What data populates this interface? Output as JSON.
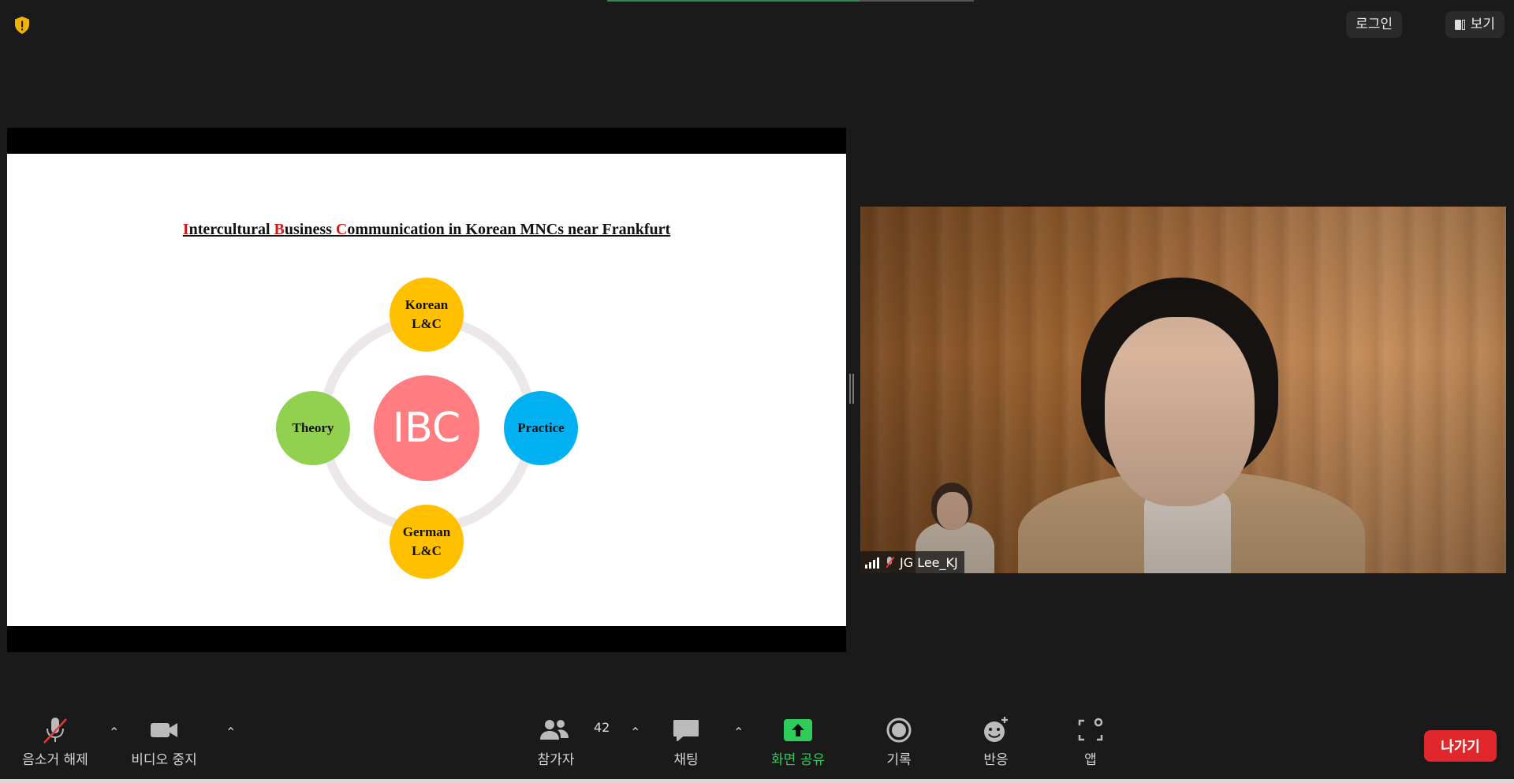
{
  "topbar": {
    "login_label": "로그인",
    "view_label": "보기"
  },
  "slide": {
    "title_parts": [
      {
        "text": "I",
        "color": "#d11b1b"
      },
      {
        "text": "ntercultural ",
        "color": "#111111"
      },
      {
        "text": "B",
        "color": "#d11b1b"
      },
      {
        "text": "usiness ",
        "color": "#111111"
      },
      {
        "text": "C",
        "color": "#d11b1b"
      },
      {
        "text": "ommunication in Korean MNCs near Frankfurt",
        "color": "#111111"
      }
    ],
    "center_label": "IBC",
    "nodes": {
      "top": [
        "Korean",
        "L&C"
      ],
      "bottom": [
        "German",
        "L&C"
      ],
      "left": "Theory",
      "right": "Practice"
    }
  },
  "video": {
    "participant_name": "JG Lee_KJ"
  },
  "toolbar": {
    "mute_label": "음소거 해제",
    "video_label": "비디오 중지",
    "participants_label": "참가자",
    "participants_count": "42",
    "chat_label": "채팅",
    "share_label": "화면 공유",
    "record_label": "기록",
    "reactions_label": "반응",
    "apps_label": "앱",
    "leave_label": "나가기"
  },
  "colors": {
    "share_green": "#2fcc5b",
    "leave_red": "#e0282c",
    "shield_yellow": "#f0b400"
  }
}
